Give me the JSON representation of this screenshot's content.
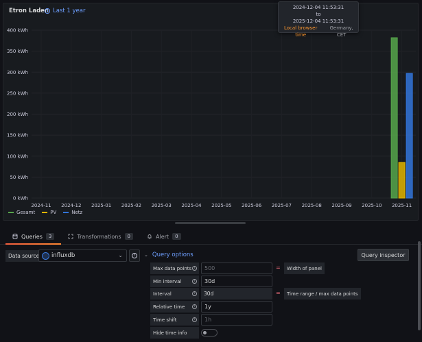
{
  "panel": {
    "title": "Etron Laden",
    "time_range": "Last 1 year"
  },
  "tooltip": {
    "from": "2024-12-04 11:53:31",
    "to_word": "to",
    "to": "2025-12-04 11:53:31",
    "tz_label": "Local browser time",
    "tz_value": "Germany, CET"
  },
  "chart_data": {
    "type": "bar",
    "title": "Etron Laden",
    "x_ticks": [
      "2024-11",
      "2024-12",
      "2025-01",
      "2025-02",
      "2025-03",
      "2025-04",
      "2025-05",
      "2025-06",
      "2025-07",
      "2025-08",
      "2025-09",
      "2025-10",
      "2025-11"
    ],
    "y_ticks": [
      "0 kWh",
      "50 kWh",
      "100 kWh",
      "150 kWh",
      "200 kWh",
      "250 kWh",
      "300 kWh",
      "350 kWh",
      "400 kWh"
    ],
    "ylim": [
      0,
      400
    ],
    "unit": "kWh",
    "grid": true,
    "legend_placement": "bottom-left",
    "categories": [
      "2025-11"
    ],
    "series": [
      {
        "name": "Gesamt",
        "color": "#56a64b",
        "values": [
          382
        ]
      },
      {
        "name": "PV",
        "color": "#e0b400",
        "values": [
          85
        ]
      },
      {
        "name": "Netz",
        "color": "#3274d9",
        "values": [
          297
        ]
      }
    ]
  },
  "tabs": [
    {
      "label": "Queries",
      "count": "3",
      "icon": "database-icon",
      "active": true
    },
    {
      "label": "Transformations",
      "count": "0",
      "icon": "transform-icon",
      "active": false
    },
    {
      "label": "Alert",
      "count": "0",
      "icon": "bell-icon",
      "active": false
    }
  ],
  "query": {
    "datasource_label": "Data source",
    "datasource_value": "influxdb",
    "options_toggle": "Query options",
    "inspector_button": "Query inspector"
  },
  "options": {
    "max_data_points": {
      "label": "Max data points",
      "placeholder": "500",
      "note": "Width of panel"
    },
    "min_interval": {
      "label": "Min interval",
      "value": "30d"
    },
    "interval": {
      "label": "Interval",
      "value": "30d",
      "note": "Time range / max data points"
    },
    "relative_time": {
      "label": "Relative time",
      "value": "1y"
    },
    "time_shift": {
      "label": "Time shift",
      "placeholder": "1h"
    },
    "hide_time_info": {
      "label": "Hide time info",
      "enabled": false
    }
  }
}
